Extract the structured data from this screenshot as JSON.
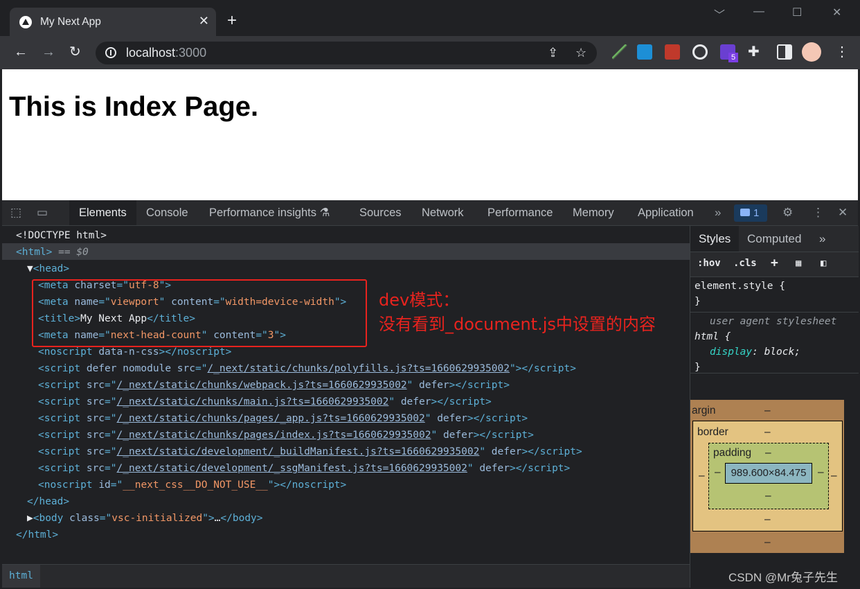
{
  "browser": {
    "tab_title": "My Next App",
    "tab_close": "✕",
    "new_tab": "+",
    "url_host": "localhost",
    "url_port": ":3000",
    "extension_badge": "5",
    "window_controls": [
      "﹀",
      "—",
      "☐",
      "✕"
    ]
  },
  "page": {
    "heading": "This is Index Page."
  },
  "devtools": {
    "tabs": [
      "Elements",
      "Console",
      "Performance insights",
      "Sources",
      "Network",
      "Performance",
      "Memory",
      "Application"
    ],
    "active_tab": "Elements",
    "more_tabs": "»",
    "issues_count": "1",
    "lines": [
      {
        "indent": 0,
        "html": "<span class='txt'>&lt;!DOCTYPE html&gt;</span>"
      },
      {
        "indent": 0,
        "html": "<span class='tag'>&lt;html&gt;</span> <span class='dim'>== $0</span>"
      },
      {
        "indent": 1,
        "html": "<span class='txt'>▼</span><span class='tag'>&lt;head&gt;</span>"
      },
      {
        "indent": 2,
        "html": "<span class='tag'>&lt;meta </span><span class='attr'>charset</span><span class='tag'>=\"</span><span class='val'>utf-8</span><span class='tag'>\"&gt;</span>"
      },
      {
        "indent": 2,
        "html": "<span class='tag'>&lt;meta </span><span class='attr'>name</span><span class='tag'>=\"</span><span class='val'>viewport</span><span class='tag'>\" </span><span class='attr'>content</span><span class='tag'>=\"</span><span class='val'>width=device-width</span><span class='tag'>\"&gt;</span>"
      },
      {
        "indent": 2,
        "html": "<span class='tag'>&lt;title&gt;</span><span class='txt'>My Next App</span><span class='tag'>&lt;/title&gt;</span>"
      },
      {
        "indent": 2,
        "html": "<span class='tag'>&lt;meta </span><span class='attr'>name</span><span class='tag'>=\"</span><span class='val'>next-head-count</span><span class='tag'>\" </span><span class='attr'>content</span><span class='tag'>=\"</span><span class='val'>3</span><span class='tag'>\"&gt;</span>"
      },
      {
        "indent": 2,
        "html": "<span class='tag'>&lt;noscript </span><span class='attr'>data-n-css</span><span class='tag'>&gt;&lt;/noscript&gt;</span>"
      },
      {
        "indent": 2,
        "html": "<span class='tag'>&lt;script </span><span class='attr'>defer nomodule src</span><span class='tag'>=\"</span><span class='link'>/_next/static/chunks/polyfills.js?ts=1660629935002</span><span class='tag'>\"&gt;&lt;/script&gt;</span>"
      },
      {
        "indent": 2,
        "html": "<span class='tag'>&lt;script </span><span class='attr'>src</span><span class='tag'>=\"</span><span class='link'>/_next/static/chunks/webpack.js?ts=1660629935002</span><span class='tag'>\" </span><span class='attr'>defer</span><span class='tag'>&gt;&lt;/script&gt;</span>"
      },
      {
        "indent": 2,
        "html": "<span class='tag'>&lt;script </span><span class='attr'>src</span><span class='tag'>=\"</span><span class='link'>/_next/static/chunks/main.js?ts=1660629935002</span><span class='tag'>\" </span><span class='attr'>defer</span><span class='tag'>&gt;&lt;/script&gt;</span>"
      },
      {
        "indent": 2,
        "html": "<span class='tag'>&lt;script </span><span class='attr'>src</span><span class='tag'>=\"</span><span class='link'>/_next/static/chunks/pages/_app.js?ts=1660629935002</span><span class='tag'>\" </span><span class='attr'>defer</span><span class='tag'>&gt;&lt;/script&gt;</span>"
      },
      {
        "indent": 2,
        "html": "<span class='tag'>&lt;script </span><span class='attr'>src</span><span class='tag'>=\"</span><span class='link'>/_next/static/chunks/pages/index.js?ts=1660629935002</span><span class='tag'>\" </span><span class='attr'>defer</span><span class='tag'>&gt;&lt;/script&gt;</span>"
      },
      {
        "indent": 2,
        "html": "<span class='tag'>&lt;script </span><span class='attr'>src</span><span class='tag'>=\"</span><span class='link'>/_next/static/development/_buildManifest.js?ts=1660629935002</span><span class='tag'>\" </span><span class='attr'>defer</span><span class='tag'>&gt;&lt;/script&gt;</span>"
      },
      {
        "indent": 2,
        "html": "<span class='tag'>&lt;script </span><span class='attr'>src</span><span class='tag'>=\"</span><span class='link'>/_next/static/development/_ssgManifest.js?ts=1660629935002</span><span class='tag'>\" </span><span class='attr'>defer</span><span class='tag'>&gt;&lt;/script&gt;</span>"
      },
      {
        "indent": 2,
        "html": "<span class='tag'>&lt;noscript </span><span class='attr'>id</span><span class='tag'>=\"</span><span class='val'>__next_css__DO_NOT_USE__</span><span class='tag'>\"&gt;&lt;/noscript&gt;</span>"
      },
      {
        "indent": 1,
        "html": "<span class='tag'>&lt;/head&gt;</span>"
      },
      {
        "indent": 1,
        "html": "<span class='txt'>▶</span><span class='tag'>&lt;body </span><span class='attr'>class</span><span class='tag'>=\"</span><span class='val'>vsc-initialized</span><span class='tag'>\"&gt;</span><span class='txt'>…</span><span class='tag'>&lt;/body&gt;</span>"
      },
      {
        "indent": 0,
        "html": "<span class='tag'>&lt;/html&gt;</span>"
      }
    ],
    "annotation_line1": "dev模式：",
    "annotation_line2": "没有看到_document.js中设置的内容",
    "breadcrumb": "html",
    "styles": {
      "tabs": [
        "Styles",
        "Computed"
      ],
      "more": "»",
      "filter_hov": ":hov",
      "filter_cls": ".cls",
      "filter_add": "+",
      "element_style_selector": "element.style {",
      "close_brace": "}",
      "ua_label": "user agent stylesheet",
      "ua_selector": "html {",
      "ua_prop": "display",
      "ua_value": ": block;"
    },
    "box_model": {
      "margin_label": "argin",
      "border_label": "border",
      "padding_label": "padding",
      "dash": "–",
      "content": "989.600×84.475"
    }
  },
  "watermark": "CSDN @Mr兔子先生"
}
